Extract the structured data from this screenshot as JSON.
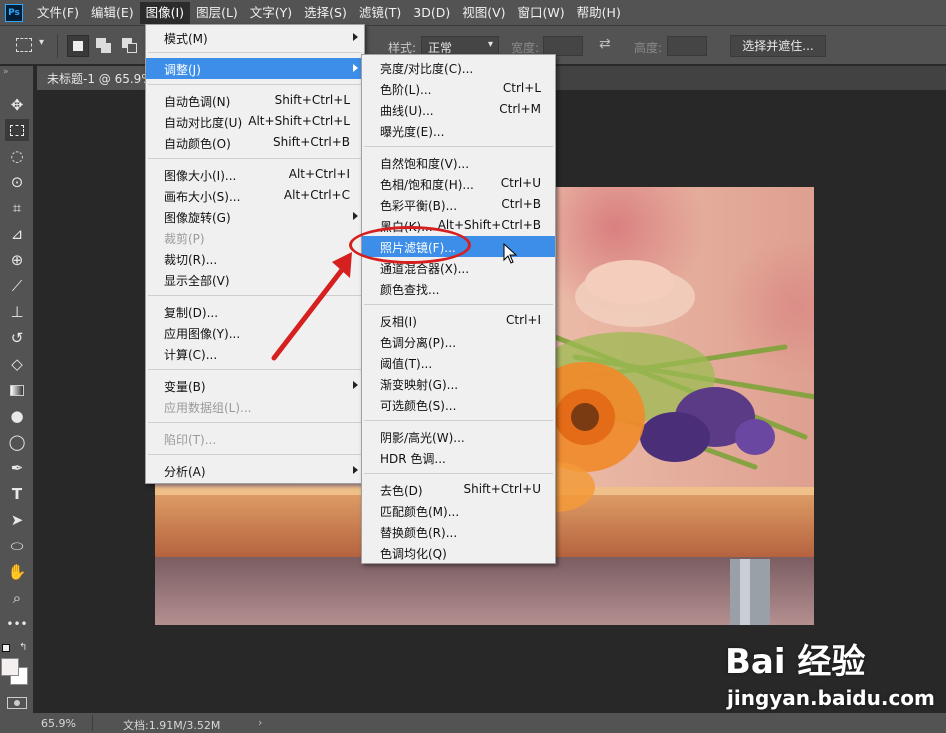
{
  "app": {
    "logo": "Ps"
  },
  "menubar": {
    "items": [
      "文件(F)",
      "编辑(E)",
      "图像(I)",
      "图层(L)",
      "文字(Y)",
      "选择(S)",
      "滤镜(T)",
      "3D(D)",
      "视图(V)",
      "窗口(W)",
      "帮助(H)"
    ],
    "active_index": 2
  },
  "options": {
    "style_label": "样式:",
    "style_value": "正常",
    "width_label": "宽度:",
    "height_label": "高度:",
    "select_mask": "选择并遮住..."
  },
  "document": {
    "tab_title": "未标题-1 @ 65.9%"
  },
  "status": {
    "zoom": "65.9%",
    "doc_info": "文档:1.91M/3.52M"
  },
  "image_menu": {
    "items": [
      {
        "label": "模式(M)",
        "shortcut": "",
        "submenu": true
      },
      {
        "label": "调整(J)",
        "shortcut": "",
        "submenu": true,
        "highlighted": true
      },
      {
        "label": "自动色调(N)",
        "shortcut": "Shift+Ctrl+L"
      },
      {
        "label": "自动对比度(U)",
        "shortcut": "Alt+Shift+Ctrl+L"
      },
      {
        "label": "自动颜色(O)",
        "shortcut": "Shift+Ctrl+B"
      },
      {
        "label": "图像大小(I)...",
        "shortcut": "Alt+Ctrl+I"
      },
      {
        "label": "画布大小(S)...",
        "shortcut": "Alt+Ctrl+C"
      },
      {
        "label": "图像旋转(G)",
        "shortcut": "",
        "submenu": true
      },
      {
        "label": "裁剪(P)",
        "shortcut": "",
        "disabled": true
      },
      {
        "label": "裁切(R)...",
        "shortcut": ""
      },
      {
        "label": "显示全部(V)",
        "shortcut": ""
      },
      {
        "label": "复制(D)...",
        "shortcut": ""
      },
      {
        "label": "应用图像(Y)...",
        "shortcut": ""
      },
      {
        "label": "计算(C)...",
        "shortcut": ""
      },
      {
        "label": "变量(B)",
        "shortcut": "",
        "submenu": true
      },
      {
        "label": "应用数据组(L)...",
        "shortcut": "",
        "disabled": true
      },
      {
        "label": "陷印(T)...",
        "shortcut": "",
        "disabled": true
      },
      {
        "label": "分析(A)",
        "shortcut": "",
        "submenu": true
      }
    ]
  },
  "adjust_menu": {
    "items": [
      {
        "label": "亮度/对比度(C)...",
        "shortcut": ""
      },
      {
        "label": "色阶(L)...",
        "shortcut": "Ctrl+L"
      },
      {
        "label": "曲线(U)...",
        "shortcut": "Ctrl+M"
      },
      {
        "label": "曝光度(E)...",
        "shortcut": ""
      },
      {
        "label": "自然饱和度(V)...",
        "shortcut": ""
      },
      {
        "label": "色相/饱和度(H)...",
        "shortcut": "Ctrl+U"
      },
      {
        "label": "色彩平衡(B)...",
        "shortcut": "Ctrl+B"
      },
      {
        "label": "黑白(K)...",
        "shortcut": "Alt+Shift+Ctrl+B"
      },
      {
        "label": "照片滤镜(F)...",
        "shortcut": "",
        "highlighted": true
      },
      {
        "label": "通道混合器(X)...",
        "shortcut": ""
      },
      {
        "label": "颜色查找...",
        "shortcut": ""
      },
      {
        "label": "反相(I)",
        "shortcut": "Ctrl+I"
      },
      {
        "label": "色调分离(P)...",
        "shortcut": ""
      },
      {
        "label": "阈值(T)...",
        "shortcut": ""
      },
      {
        "label": "渐变映射(G)...",
        "shortcut": ""
      },
      {
        "label": "可选颜色(S)...",
        "shortcut": ""
      },
      {
        "label": "阴影/高光(W)...",
        "shortcut": ""
      },
      {
        "label": "HDR 色调...",
        "shortcut": ""
      },
      {
        "label": "去色(D)",
        "shortcut": "Shift+Ctrl+U"
      },
      {
        "label": "匹配颜色(M)...",
        "shortcut": ""
      },
      {
        "label": "替换颜色(R)...",
        "shortcut": ""
      },
      {
        "label": "色调均化(Q)",
        "shortcut": ""
      }
    ]
  },
  "watermark": {
    "brand": "Bai 经验",
    "url": "jingyan.baidu.com"
  },
  "colors": {
    "highlight": "#3d8ee8",
    "annotation": "#d61f1f",
    "chrome": "#535353"
  }
}
